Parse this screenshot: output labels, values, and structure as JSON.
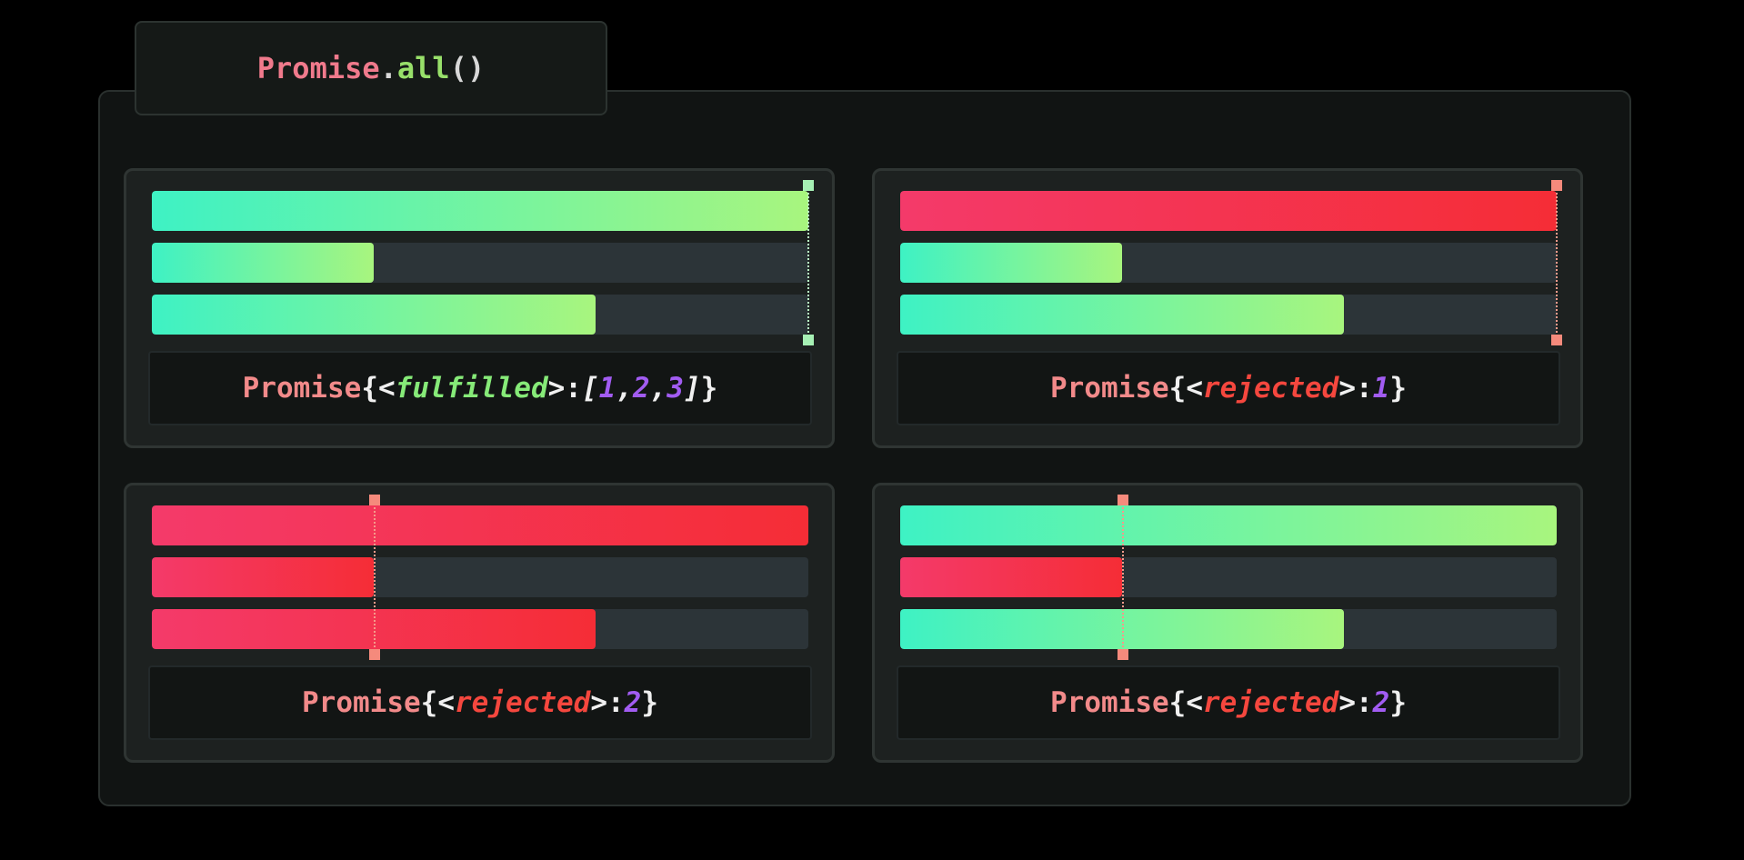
{
  "title": {
    "object": "Promise",
    "dot": ".",
    "method": "all",
    "parens": "()"
  },
  "panels": [
    {
      "id": "top-left",
      "marker_color": "green",
      "bars": [
        {
          "color": "green",
          "progress": 1.0
        },
        {
          "color": "green",
          "progress": 0.338
        },
        {
          "color": "green",
          "progress": 0.676
        }
      ],
      "marker_at": 1.0,
      "result": {
        "prefix": "Promise",
        "open": "{",
        "lt": "<",
        "state": "fulfilled",
        "gt_colon": ">:",
        "value_open": "[",
        "v1": "1",
        "sep1": ",",
        "v2": "2",
        "sep2": ",",
        "v3": "3",
        "value_close": "]",
        "close": "}"
      }
    },
    {
      "id": "top-right",
      "marker_color": "red",
      "bars": [
        {
          "color": "red",
          "progress": 1.0
        },
        {
          "color": "green",
          "progress": 0.338
        },
        {
          "color": "green",
          "progress": 0.676
        }
      ],
      "marker_at": 1.0,
      "result": {
        "prefix": "Promise",
        "open": "{",
        "lt": "<",
        "state": "rejected",
        "gt_colon": ">:",
        "value": "1",
        "close": "}"
      }
    },
    {
      "id": "bottom-left",
      "marker_color": "red",
      "bars": [
        {
          "color": "red",
          "progress": 1.0
        },
        {
          "color": "red",
          "progress": 0.338
        },
        {
          "color": "red",
          "progress": 0.676
        }
      ],
      "marker_at": 0.338,
      "result": {
        "prefix": "Promise",
        "open": "{",
        "lt": "<",
        "state": "rejected",
        "gt_colon": ">:",
        "value": "2",
        "close": "}"
      }
    },
    {
      "id": "bottom-right",
      "marker_color": "red",
      "bars": [
        {
          "color": "green",
          "progress": 1.0
        },
        {
          "color": "red",
          "progress": 0.338
        },
        {
          "color": "green",
          "progress": 0.676
        }
      ],
      "marker_at": 0.338,
      "result": {
        "prefix": "Promise",
        "open": "{",
        "lt": "<",
        "state": "rejected",
        "gt_colon": ">:",
        "value": "2",
        "close": "}"
      }
    }
  ],
  "colors": {
    "green_start": "#3ef2c4",
    "green_end": "#a8f57e",
    "red_start": "#f43a6a",
    "red_end": "#f52d36",
    "track": "#2c3438"
  }
}
